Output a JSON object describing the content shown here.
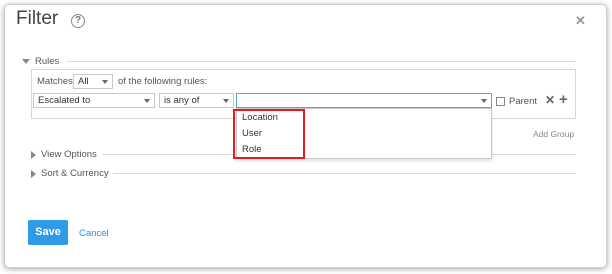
{
  "dialog": {
    "title": "Filter",
    "help_glyph": "?",
    "close_glyph": "✕"
  },
  "rules": {
    "section_label": "Rules",
    "matches_label": "Matches",
    "matches_value": "All",
    "following_label": "of the following rules:",
    "field_value": "Escalated to",
    "operator_value": "is any of",
    "value_value": "",
    "parent_label": "Parent",
    "parent_checked": false,
    "remove_glyph": "✕",
    "add_glyph": "+",
    "add_group_label": "Add Group"
  },
  "dropdown": {
    "options": [
      "Location",
      "User",
      "Role"
    ]
  },
  "sections": {
    "view_options": "View Options",
    "sort_currency": "Sort & Currency"
  },
  "footer": {
    "save_label": "Save",
    "cancel_label": "Cancel"
  },
  "colors": {
    "primary_button": "#2f9ae8",
    "link": "#2b8fd9",
    "highlight_box": "#e41b23",
    "focus_border": "#5aa6e0"
  }
}
